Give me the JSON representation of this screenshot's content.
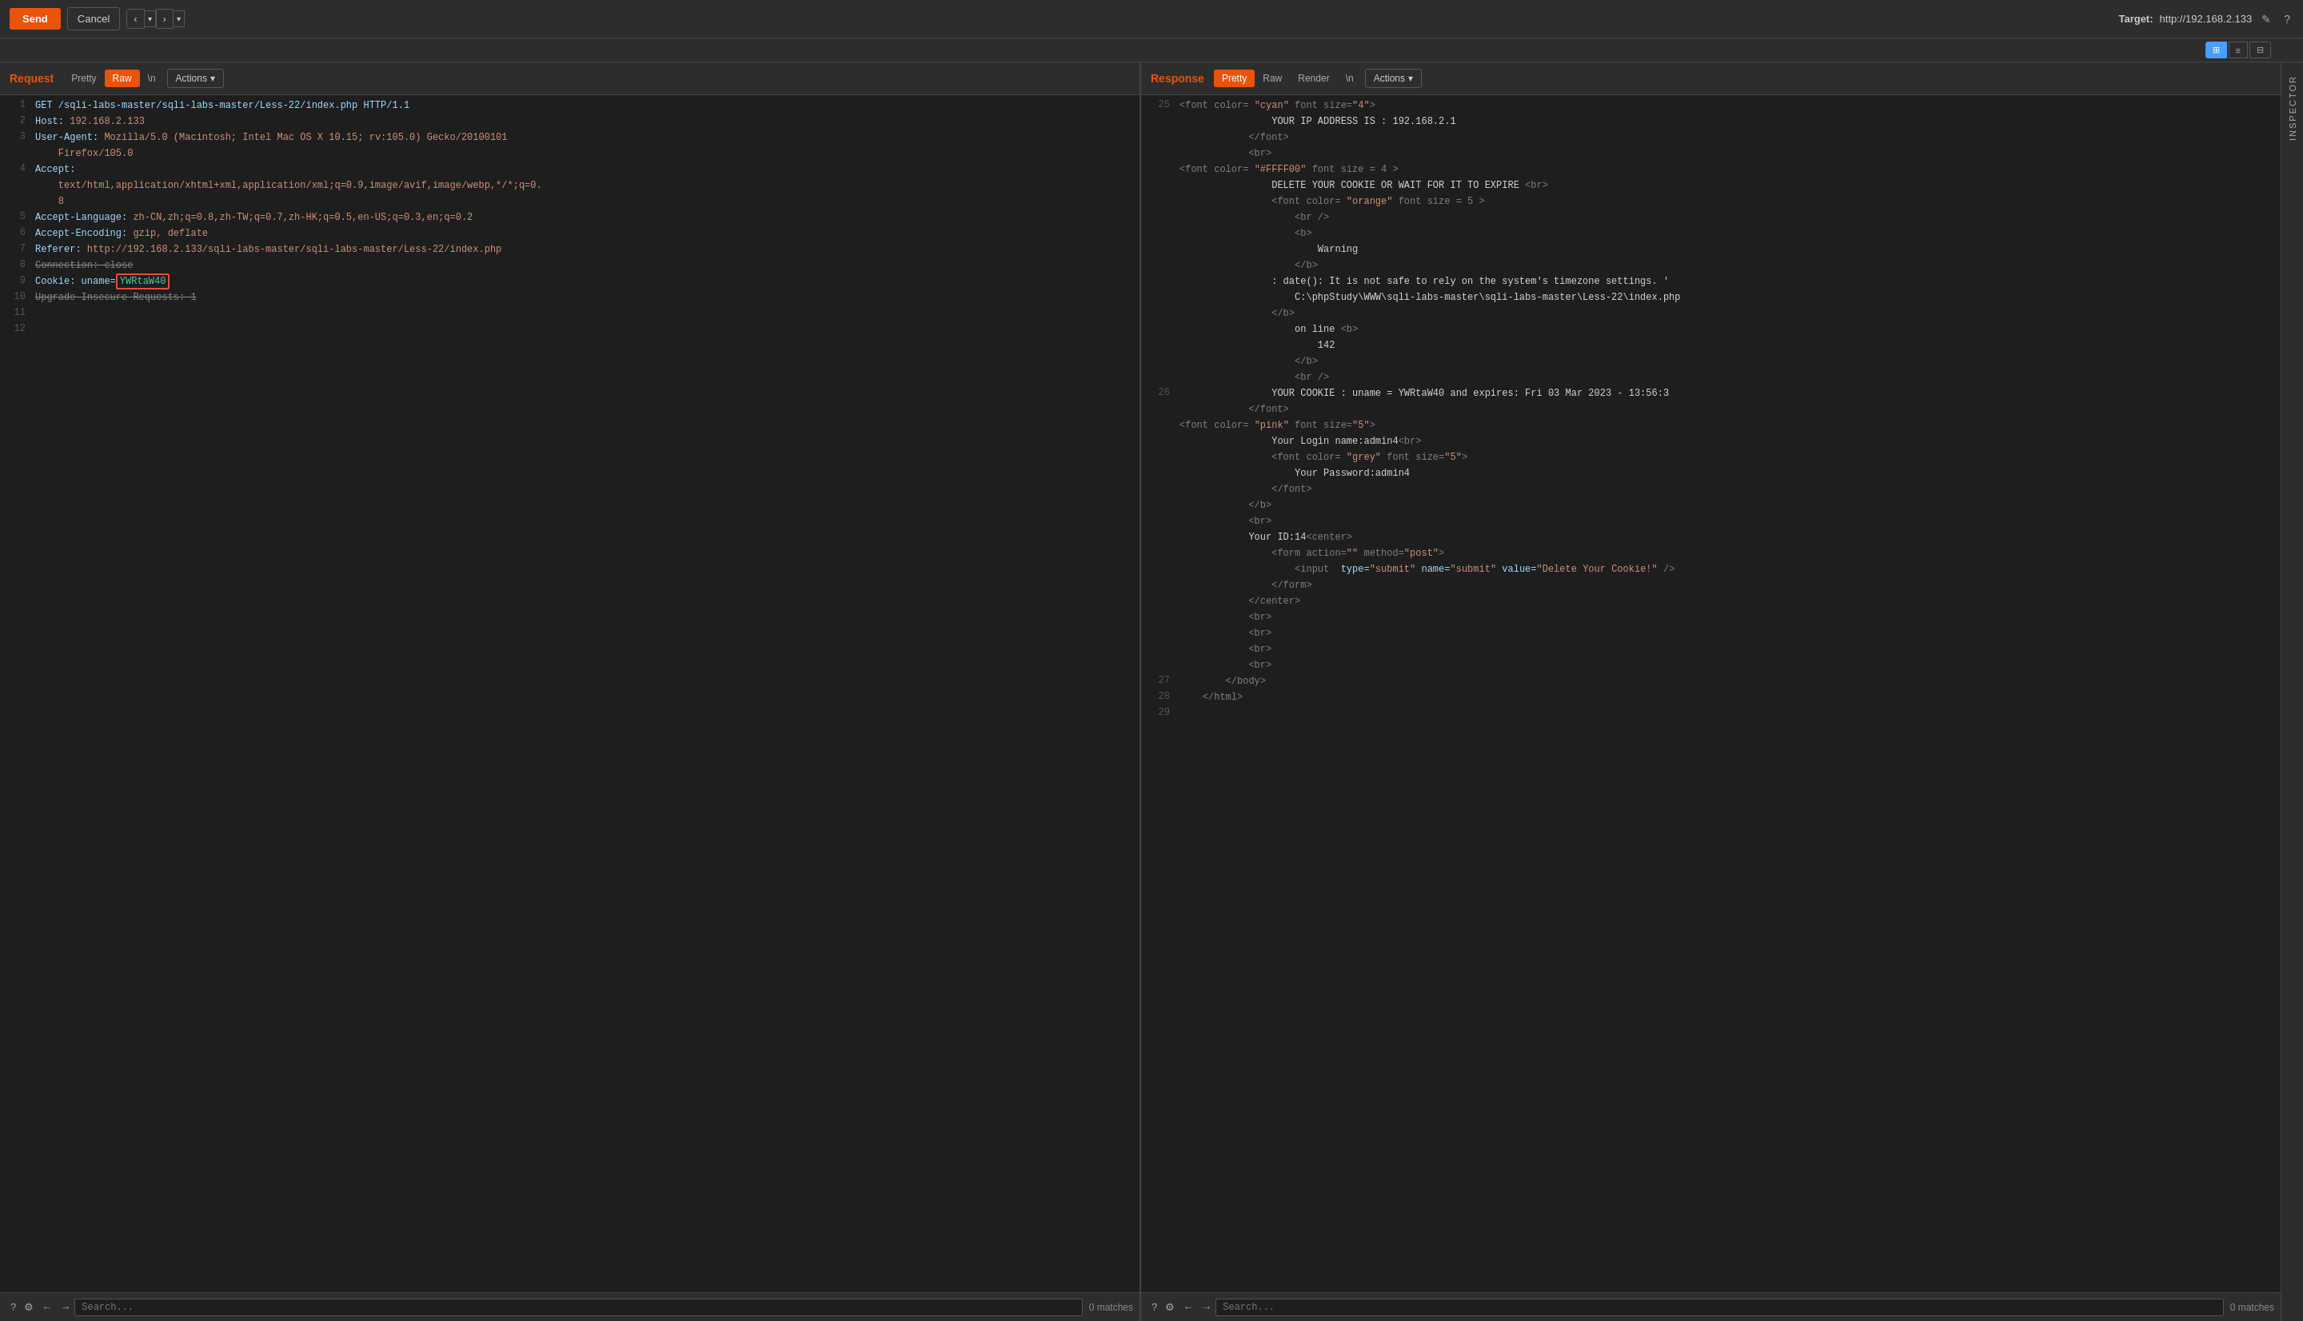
{
  "toolbar": {
    "send_label": "Send",
    "cancel_label": "Cancel",
    "nav_left": "‹",
    "nav_right": "›",
    "target_prefix": "Target:",
    "target_url": "http://192.168.2.133",
    "edit_icon": "✎",
    "help_icon": "?"
  },
  "view_modes": {
    "grid_icon": "⊞",
    "list_icon": "≡",
    "split_icon": "⊟"
  },
  "inspector": {
    "label": "INSPECTOR"
  },
  "request": {
    "title": "Request",
    "tabs": [
      "Pretty",
      "Raw",
      "\\n"
    ],
    "active_tab": "Raw",
    "actions_label": "Actions",
    "lines": [
      {
        "num": "1",
        "content": "GET /sqli-labs-master/sqli-labs-master/Less-22/index.php HTTP/1.1",
        "type": "method"
      },
      {
        "num": "2",
        "content": "Host: 192.168.2.133",
        "type": "header"
      },
      {
        "num": "3",
        "content": "User-Agent: Mozilla/5.0 (Macintosh; Intel Mac OS X 10.15; rv:105.0) Gecko/20100101",
        "type": "header"
      },
      {
        "num": "",
        "content": "    Firefox/105.0",
        "type": "continuation"
      },
      {
        "num": "4",
        "content": "Accept:",
        "type": "header"
      },
      {
        "num": "",
        "content": "    text/html,application/xhtml+xml,application/xml;q=0.9,image/avif,image/webp,*/*;q=0.",
        "type": "continuation"
      },
      {
        "num": "",
        "content": "    8",
        "type": "continuation"
      },
      {
        "num": "5",
        "content": "Accept-Language: zh-CN,zh;q=0.8,zh-TW;q=0.7,zh-HK;q=0.5,en-US;q=0.3,en;q=0.2",
        "type": "header"
      },
      {
        "num": "6",
        "content": "Accept-Encoding: gzip, deflate",
        "type": "header"
      },
      {
        "num": "7",
        "content": "Referer: http://192.168.2.133/sqli-labs-master/sqli-labs-master/Less-22/index.php",
        "type": "header"
      },
      {
        "num": "8",
        "content": "Connection: close",
        "type": "strikethrough"
      },
      {
        "num": "9",
        "content": "Cookie: uname=YWRtaW40",
        "type": "cookie_highlighted"
      },
      {
        "num": "10",
        "content": "Upgrade-Insecure-Requests: 1",
        "type": "strikethrough"
      },
      {
        "num": "11",
        "content": "",
        "type": "empty"
      },
      {
        "num": "12",
        "content": "",
        "type": "empty"
      }
    ]
  },
  "response": {
    "title": "Response",
    "tabs": [
      "Pretty",
      "Raw",
      "Render",
      "\\n"
    ],
    "active_tab": "Pretty",
    "actions_label": "Actions",
    "view_modes": [
      "grid",
      "list",
      "split"
    ],
    "active_view": "grid",
    "lines": [
      {
        "num": "25",
        "content": "            <font color= \"cyan\" font size=\"4\">",
        "type": "tag"
      },
      {
        "num": "",
        "content": "                YOUR IP ADDRESS IS : 192.168.2.1",
        "type": "text"
      },
      {
        "num": "",
        "content": "            </font>",
        "type": "tag"
      },
      {
        "num": "",
        "content": "            <br>",
        "type": "tag"
      },
      {
        "num": "",
        "content": "            <font color= \"#FFFF00\" font size = 4 >",
        "type": "tag"
      },
      {
        "num": "",
        "content": "                DELETE YOUR COOKIE OR WAIT FOR IT TO EXPIRE <br>",
        "type": "text"
      },
      {
        "num": "",
        "content": "                <font color= \"orange\" font size = 5 >",
        "type": "tag"
      },
      {
        "num": "",
        "content": "                    <br />",
        "type": "tag"
      },
      {
        "num": "",
        "content": "                    <b>",
        "type": "tag"
      },
      {
        "num": "",
        "content": "                        Warning",
        "type": "text"
      },
      {
        "num": "",
        "content": "                    </b>",
        "type": "tag"
      },
      {
        "num": "",
        "content": "                : date(): It is not safe to rely on the system's timezone settings. '",
        "type": "text"
      },
      {
        "num": "",
        "content": "                    C:\\phpStudy\\WWW\\sqli-labs-master\\sqli-labs-master\\Less-22\\index.php",
        "type": "text"
      },
      {
        "num": "",
        "content": "                </b>",
        "type": "tag"
      },
      {
        "num": "",
        "content": "                    on line <b>",
        "type": "tag"
      },
      {
        "num": "",
        "content": "                        142",
        "type": "text"
      },
      {
        "num": "",
        "content": "                    </b>",
        "type": "tag"
      },
      {
        "num": "",
        "content": "                    <br />",
        "type": "tag"
      },
      {
        "num": "26",
        "content": "                YOUR COOKIE : uname = YWRtaW40 and expires: Fri 03 Mar 2023 - 13:56:3",
        "type": "text"
      },
      {
        "num": "",
        "content": "            </font>",
        "type": "tag"
      },
      {
        "num": "",
        "content": "            <font color= \"pink\" font size=\"5\">",
        "type": "tag"
      },
      {
        "num": "",
        "content": "                Your Login name:admin4<br>",
        "type": "text"
      },
      {
        "num": "",
        "content": "                <font color= \"grey\" font size=\"5\">",
        "type": "tag"
      },
      {
        "num": "",
        "content": "                    Your Password:admin4",
        "type": "text"
      },
      {
        "num": "",
        "content": "                </font>",
        "type": "tag"
      },
      {
        "num": "",
        "content": "            </b>",
        "type": "tag"
      },
      {
        "num": "",
        "content": "            <br>",
        "type": "tag"
      },
      {
        "num": "",
        "content": "            Your ID:14<center>",
        "type": "text"
      },
      {
        "num": "",
        "content": "                <form action=\"\" method=\"post\">",
        "type": "tag"
      },
      {
        "num": "",
        "content": "                    <input  type=\"submit\" name=\"submit\" value=\"Delete Your Cookie!\" />",
        "type": "tag"
      },
      {
        "num": "",
        "content": "                </form>",
        "type": "tag"
      },
      {
        "num": "",
        "content": "            </center>",
        "type": "tag"
      },
      {
        "num": "",
        "content": "            <br>",
        "type": "tag"
      },
      {
        "num": "",
        "content": "            <br>",
        "type": "tag"
      },
      {
        "num": "",
        "content": "            <br>",
        "type": "tag"
      },
      {
        "num": "",
        "content": "            <br>",
        "type": "tag"
      },
      {
        "num": "27",
        "content": "        </body>",
        "type": "tag"
      },
      {
        "num": "28",
        "content": "    </html>",
        "type": "tag"
      },
      {
        "num": "29",
        "content": "",
        "type": "empty"
      }
    ]
  },
  "bottom_bars": {
    "request": {
      "search_placeholder": "Search...",
      "matches": "0 matches"
    },
    "response": {
      "search_placeholder": "Search...",
      "matches": "0 matches"
    }
  }
}
